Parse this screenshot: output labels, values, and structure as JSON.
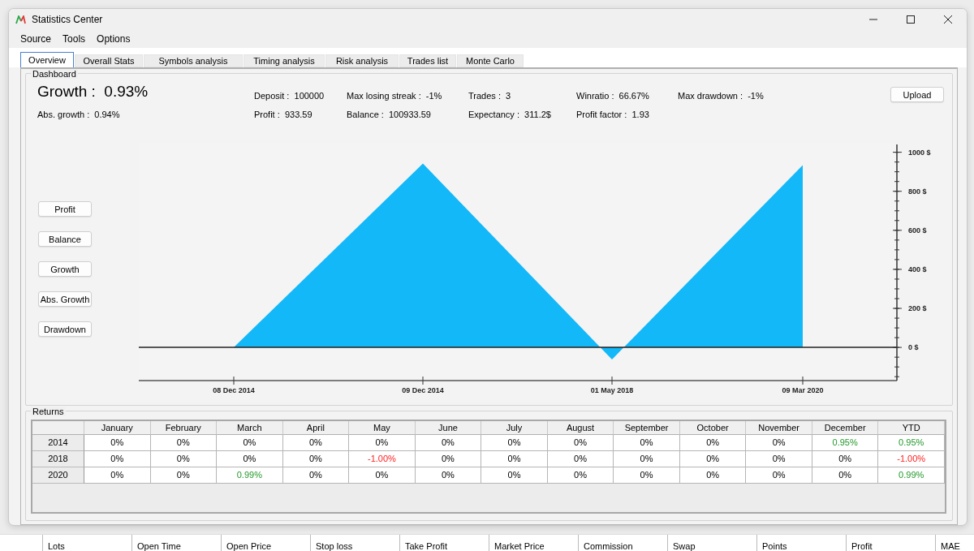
{
  "window": {
    "title": "Statistics Center"
  },
  "menu": [
    "Source",
    "Tools",
    "Options"
  ],
  "tabs": [
    {
      "label": "Overview",
      "selected": true
    },
    {
      "label": "Overall Stats",
      "selected": false
    },
    {
      "label": "Symbols analysis",
      "selected": false
    },
    {
      "label": "Timing analysis",
      "selected": false
    },
    {
      "label": "Risk analysis",
      "selected": false
    },
    {
      "label": "Trades list",
      "selected": false
    },
    {
      "label": "Monte Carlo",
      "selected": false
    }
  ],
  "dashboard": {
    "title": "Dashboard",
    "stat_columns": [
      [
        {
          "kind": "headline",
          "label": "Growth :",
          "value": "0.93%"
        },
        {
          "kind": "stat",
          "label": "Abs. growth :",
          "value": "0.94%"
        }
      ],
      [
        {
          "kind": "stat",
          "label": "Deposit :",
          "value": "100000"
        },
        {
          "kind": "stat",
          "label": "Profit :",
          "value": "933.59"
        }
      ],
      [
        {
          "kind": "stat",
          "label": "Max losing streak :",
          "value": "-1%"
        },
        {
          "kind": "stat",
          "label": "Balance :",
          "value": "100933.59"
        }
      ],
      [
        {
          "kind": "stat",
          "label": "Trades :",
          "value": "3"
        },
        {
          "kind": "stat",
          "label": "Expectancy :",
          "value": "311.2$"
        }
      ],
      [
        {
          "kind": "stat",
          "label": "Winratio :",
          "value": "66.67%"
        },
        {
          "kind": "stat",
          "label": "Profit factor :",
          "value": "1.93"
        }
      ],
      [
        {
          "kind": "stat",
          "label": "Max drawdown :",
          "value": "-1%"
        }
      ]
    ],
    "upload_button": "Upload",
    "chart_buttons": [
      "Profit",
      "Balance",
      "Growth",
      "Abs. Growth",
      "Drawdown"
    ],
    "chart_data": {
      "type": "area",
      "categories": [
        "08 Dec 2014",
        "09 Dec 2014",
        "01 May 2018",
        "09 Mar 2020"
      ],
      "series": [
        {
          "color": "#13b8f8",
          "values": [
            0,
            942,
            -62,
            934
          ]
        }
      ],
      "ylim": [
        -170,
        1040
      ],
      "yticks": [
        {
          "value": 0,
          "label": "0 $"
        },
        {
          "value": 200,
          "label": "200 $"
        },
        {
          "value": 400,
          "label": "400 $"
        },
        {
          "value": 600,
          "label": "600 $"
        },
        {
          "value": 800,
          "label": "800 $"
        },
        {
          "value": 1000,
          "label": "1000 $"
        }
      ]
    }
  },
  "returns": {
    "title": "Returns",
    "columns": [
      "January",
      "February",
      "March",
      "April",
      "May",
      "June",
      "July",
      "August",
      "September",
      "October",
      "November",
      "December",
      "YTD"
    ],
    "rows": [
      {
        "year": "2014",
        "cells": [
          {
            "text": "0%",
            "positive": false,
            "negative": false
          },
          {
            "text": "0%",
            "positive": false,
            "negative": false
          },
          {
            "text": "0%",
            "positive": false,
            "negative": false
          },
          {
            "text": "0%",
            "positive": false,
            "negative": false
          },
          {
            "text": "0%",
            "positive": false,
            "negative": false
          },
          {
            "text": "0%",
            "positive": false,
            "negative": false
          },
          {
            "text": "0%",
            "positive": false,
            "negative": false
          },
          {
            "text": "0%",
            "positive": false,
            "negative": false
          },
          {
            "text": "0%",
            "positive": false,
            "negative": false
          },
          {
            "text": "0%",
            "positive": false,
            "negative": false
          },
          {
            "text": "0%",
            "positive": false,
            "negative": false
          },
          {
            "text": "0.95%",
            "positive": true,
            "negative": false
          },
          {
            "text": "0.95%",
            "positive": true,
            "negative": false
          }
        ]
      },
      {
        "year": "2018",
        "cells": [
          {
            "text": "0%",
            "positive": false,
            "negative": false
          },
          {
            "text": "0%",
            "positive": false,
            "negative": false
          },
          {
            "text": "0%",
            "positive": false,
            "negative": false
          },
          {
            "text": "0%",
            "positive": false,
            "negative": false
          },
          {
            "text": "-1.00%",
            "positive": false,
            "negative": true
          },
          {
            "text": "0%",
            "positive": false,
            "negative": false
          },
          {
            "text": "0%",
            "positive": false,
            "negative": false
          },
          {
            "text": "0%",
            "positive": false,
            "negative": false
          },
          {
            "text": "0%",
            "positive": false,
            "negative": false
          },
          {
            "text": "0%",
            "positive": false,
            "negative": false
          },
          {
            "text": "0%",
            "positive": false,
            "negative": false
          },
          {
            "text": "0%",
            "positive": false,
            "negative": false
          },
          {
            "text": "-1.00%",
            "positive": false,
            "negative": true
          }
        ]
      },
      {
        "year": "2020",
        "cells": [
          {
            "text": "0%",
            "positive": false,
            "negative": false
          },
          {
            "text": "0%",
            "positive": false,
            "negative": false
          },
          {
            "text": "0.99%",
            "positive": true,
            "negative": false
          },
          {
            "text": "0%",
            "positive": false,
            "negative": false
          },
          {
            "text": "0%",
            "positive": false,
            "negative": false
          },
          {
            "text": "0%",
            "positive": false,
            "negative": false
          },
          {
            "text": "0%",
            "positive": false,
            "negative": false
          },
          {
            "text": "0%",
            "positive": false,
            "negative": false
          },
          {
            "text": "0%",
            "positive": false,
            "negative": false
          },
          {
            "text": "0%",
            "positive": false,
            "negative": false
          },
          {
            "text": "0%",
            "positive": false,
            "negative": false
          },
          {
            "text": "0%",
            "positive": false,
            "negative": false
          },
          {
            "text": "0.99%",
            "positive": true,
            "negative": false
          }
        ]
      }
    ]
  },
  "trades_header": [
    "Lots",
    "Open Time",
    "Open Price",
    "Stop loss",
    "Take Profit",
    "Market Price",
    "Commission",
    "Swap",
    "Points",
    "Profit",
    "MAE"
  ]
}
